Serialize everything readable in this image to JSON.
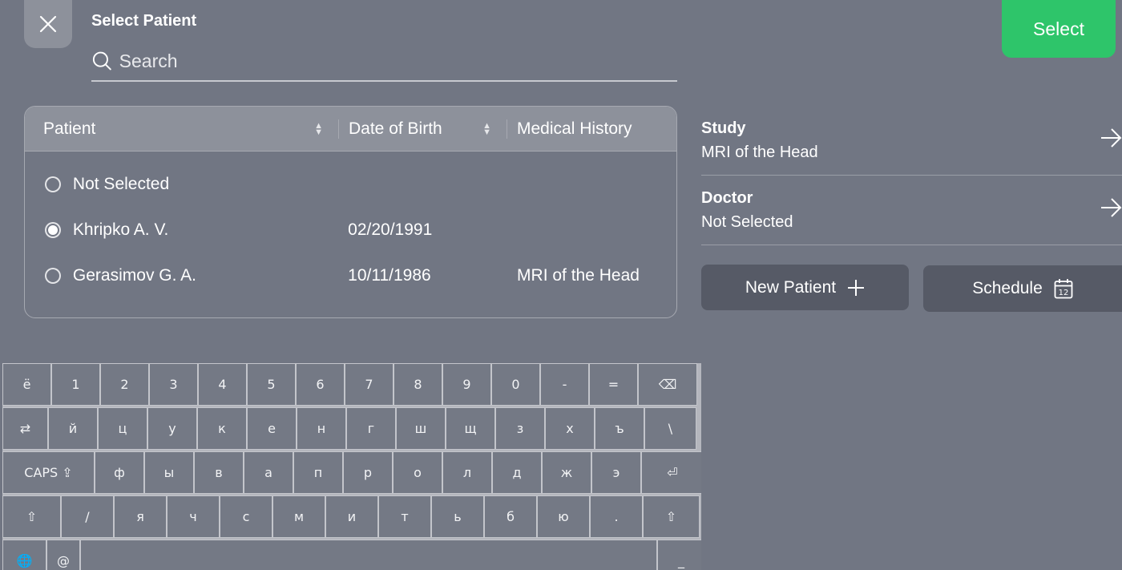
{
  "header": {
    "title": "Select Patient",
    "search_placeholder": "Search",
    "select_label": "Select"
  },
  "table": {
    "columns": [
      "Patient",
      "Date of Birth",
      "Medical History"
    ],
    "rows": [
      {
        "name": "Not Selected",
        "dob": "",
        "history": "",
        "selected": false
      },
      {
        "name": "Khripko A. V.",
        "dob": "02/20/1991",
        "history": "",
        "selected": true
      },
      {
        "name": "Gerasimov G. A.",
        "dob": "10/11/1986",
        "history": "MRI of the Head",
        "selected": false
      }
    ]
  },
  "study": {
    "label": "Study",
    "value": "MRI of the Head"
  },
  "doctor": {
    "label": "Doctor",
    "value": "Not Selected"
  },
  "actions": {
    "new_patient": "New Patient",
    "schedule": "Schedule",
    "calendar_day": "12"
  },
  "keyboard": {
    "rows": [
      [
        "ё",
        "1",
        "2",
        "3",
        "4",
        "5",
        "6",
        "7",
        "8",
        "9",
        "0",
        "-",
        "=",
        "⌫"
      ],
      [
        "⇄",
        "й",
        "ц",
        "у",
        "к",
        "е",
        "н",
        "г",
        "ш",
        "щ",
        "з",
        "х",
        "ъ",
        "\\"
      ],
      [
        "CAPS ⇪",
        "ф",
        "ы",
        "в",
        "а",
        "п",
        "р",
        "о",
        "л",
        "д",
        "ж",
        "э",
        "⏎"
      ],
      [
        "⇧",
        "/",
        "я",
        "ч",
        "с",
        "м",
        "и",
        "т",
        "ь",
        "б",
        "ю",
        ".",
        "⇧"
      ],
      [
        "🌐",
        "@",
        "",
        "_"
      ]
    ]
  },
  "colors": {
    "accent": "#2ec56a",
    "background": "#717683",
    "button": "#565a66"
  }
}
